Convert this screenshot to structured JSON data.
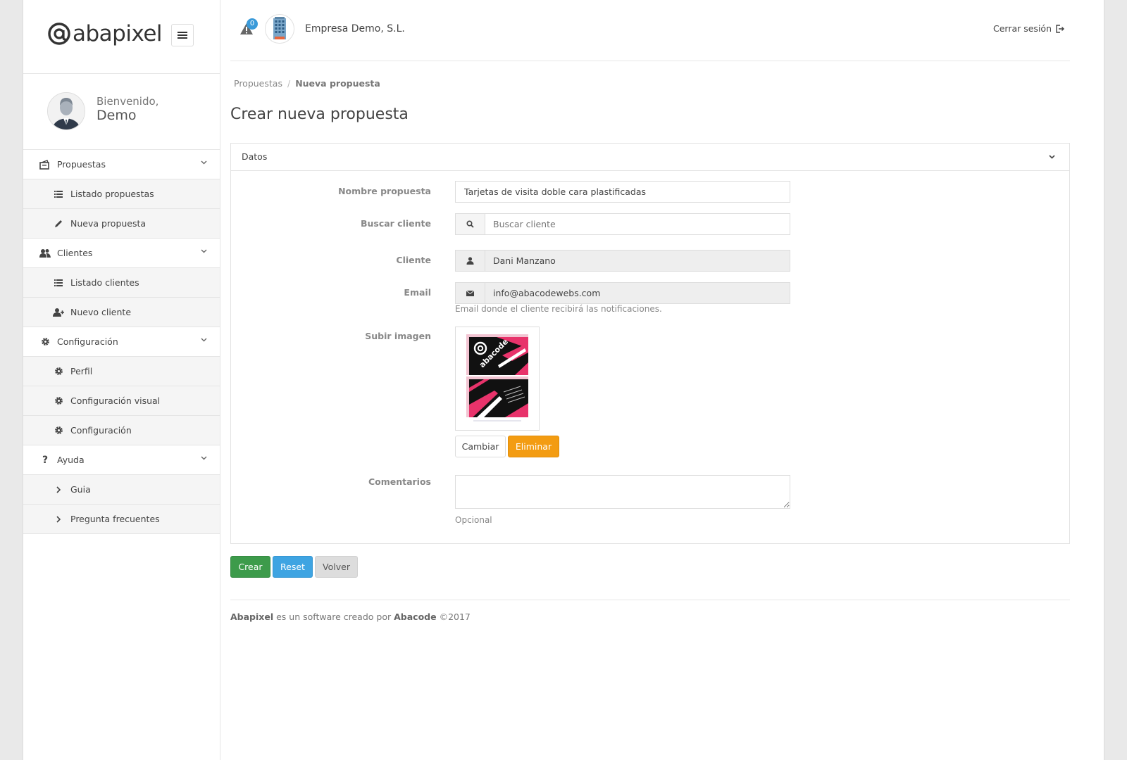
{
  "brand": {
    "name": "abapixel"
  },
  "user": {
    "welcome": "Bienvenido,",
    "name": "Demo"
  },
  "sidebar": {
    "items": [
      {
        "label": "Propuestas",
        "icon": "proposals-icon",
        "type": "section"
      },
      {
        "label": "Listado propuestas",
        "icon": "list-icon",
        "type": "sub"
      },
      {
        "label": "Nueva propuesta",
        "icon": "pencil-icon",
        "type": "sub"
      },
      {
        "label": "Clientes",
        "icon": "users-icon",
        "type": "section"
      },
      {
        "label": "Listado clientes",
        "icon": "list-icon",
        "type": "sub"
      },
      {
        "label": "Nuevo cliente",
        "icon": "user-plus-icon",
        "type": "sub"
      },
      {
        "label": "Configuración",
        "icon": "gear-icon",
        "type": "section"
      },
      {
        "label": "Perfil",
        "icon": "gear-icon",
        "type": "sub"
      },
      {
        "label": "Configuración visual",
        "icon": "gear-icon",
        "type": "sub"
      },
      {
        "label": "Configuración",
        "icon": "gear-icon",
        "type": "sub"
      },
      {
        "label": "Ayuda",
        "icon": "question-icon",
        "type": "section"
      },
      {
        "label": "Guia",
        "icon": "chevron-right-icon",
        "type": "sub"
      },
      {
        "label": "Pregunta frecuentes",
        "icon": "chevron-right-icon",
        "type": "sub"
      }
    ]
  },
  "header": {
    "alerts_count": "0",
    "company": "Empresa Demo, S.L.",
    "logout": "Cerrar sesión"
  },
  "breadcrumb": {
    "parent": "Propuestas",
    "current": "Nueva propuesta"
  },
  "page": {
    "title": "Crear nueva propuesta"
  },
  "panel": {
    "title": "Datos"
  },
  "form": {
    "nombre_label": "Nombre propuesta",
    "nombre_value": "Tarjetas de visita doble cara plastificadas",
    "buscar_label": "Buscar cliente",
    "buscar_placeholder": "Buscar cliente",
    "cliente_label": "Cliente",
    "cliente_value": "Dani Manzano",
    "email_label": "Email",
    "email_value": "info@abacodewebs.com",
    "email_help": "Email donde el cliente recibirá las notificaciones.",
    "imagen_label": "Subir imagen",
    "imagen_brand": "abacode",
    "cambiar": "Cambiar",
    "eliminar": "Eliminar",
    "comentarios_label": "Comentarios",
    "comentarios_value": "",
    "comentarios_help": "Opcional"
  },
  "actions": {
    "crear": "Crear",
    "reset": "Reset",
    "volver": "Volver"
  },
  "footer": {
    "brand": "Abapixel",
    "text": "es un software creado por",
    "company": "Abacode",
    "year": "©2017"
  },
  "colors": {
    "accent_blue": "#3ea4e2",
    "success": "#3d9b4b",
    "warning": "#f39c12",
    "card_pink": "#e8336b"
  }
}
